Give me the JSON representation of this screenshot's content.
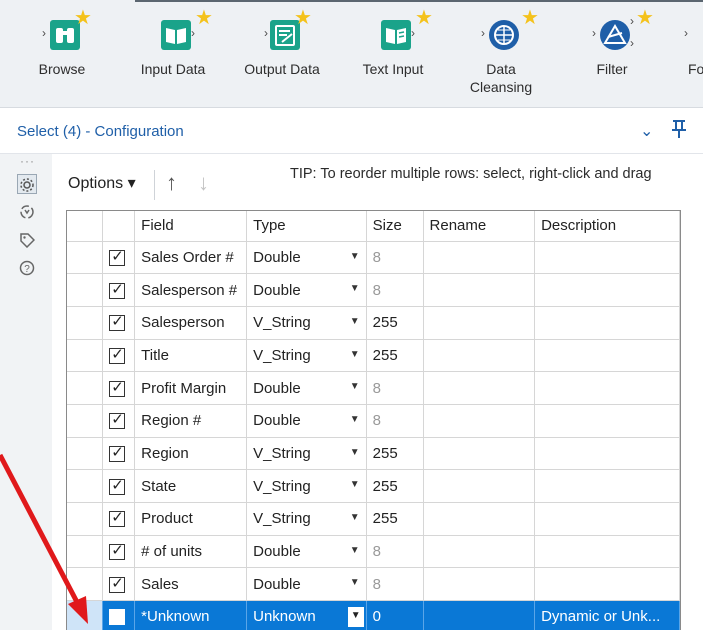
{
  "palette": {
    "tools": [
      {
        "label": "Browse",
        "color": "#1aa38a",
        "icon": "binoculars-icon"
      },
      {
        "label": "Input Data",
        "color": "#1aa38a",
        "icon": "book-open-icon"
      },
      {
        "label": "Output Data",
        "color": "#1aa38a",
        "icon": "document-pen-icon"
      },
      {
        "label": "Text Input",
        "color": "#1aa38a",
        "icon": "book-lines-icon"
      },
      {
        "label": "Data\nCleansing",
        "color": "#1f5fa8",
        "icon": "globe-grid-icon"
      },
      {
        "label": "Filter",
        "color": "#1f5fa8",
        "icon": "filter-triangle-icon"
      },
      {
        "label": "Fo",
        "color": "#1f5fa8",
        "icon": "formula-icon"
      }
    ]
  },
  "config": {
    "title": "Select (4) - Configuration",
    "collapse_icon": "chevron-down-icon",
    "pin_icon": "pin-icon"
  },
  "options": {
    "label": "Options ▾",
    "tip": "TIP: To reorder multiple rows: select, right-click and drag"
  },
  "grid": {
    "columns": [
      "Field",
      "Type",
      "Size",
      "Rename",
      "Description"
    ],
    "rows": [
      {
        "checked": true,
        "field": "Sales Order #",
        "type": "Double",
        "size": "8",
        "size_grey": true,
        "rename": "",
        "description": ""
      },
      {
        "checked": true,
        "field": "Salesperson #",
        "type": "Double",
        "size": "8",
        "size_grey": true,
        "rename": "",
        "description": ""
      },
      {
        "checked": true,
        "field": "Salesperson",
        "type": "V_String",
        "size": "255",
        "size_grey": false,
        "rename": "",
        "description": ""
      },
      {
        "checked": true,
        "field": "Title",
        "type": "V_String",
        "size": "255",
        "size_grey": false,
        "rename": "",
        "description": ""
      },
      {
        "checked": true,
        "field": "Profit Margin",
        "type": "Double",
        "size": "8",
        "size_grey": true,
        "rename": "",
        "description": ""
      },
      {
        "checked": true,
        "field": "Region #",
        "type": "Double",
        "size": "8",
        "size_grey": true,
        "rename": "",
        "description": ""
      },
      {
        "checked": true,
        "field": "Region",
        "type": "V_String",
        "size": "255",
        "size_grey": false,
        "rename": "",
        "description": ""
      },
      {
        "checked": true,
        "field": "State",
        "type": "V_String",
        "size": "255",
        "size_grey": false,
        "rename": "",
        "description": ""
      },
      {
        "checked": true,
        "field": "Product",
        "type": "V_String",
        "size": "255",
        "size_grey": false,
        "rename": "",
        "description": ""
      },
      {
        "checked": true,
        "field": "# of units",
        "type": "Double",
        "size": "8",
        "size_grey": true,
        "rename": "",
        "description": ""
      },
      {
        "checked": true,
        "field": "Sales",
        "type": "Double",
        "size": "8",
        "size_grey": true,
        "rename": "",
        "description": ""
      },
      {
        "checked": false,
        "field": "*Unknown",
        "type": "Unknown",
        "size": "0",
        "size_grey": false,
        "rename": "",
        "description": "Dynamic or Unk...",
        "selected": true
      }
    ]
  },
  "annotation": {
    "arrow_color": "#e0191b"
  }
}
